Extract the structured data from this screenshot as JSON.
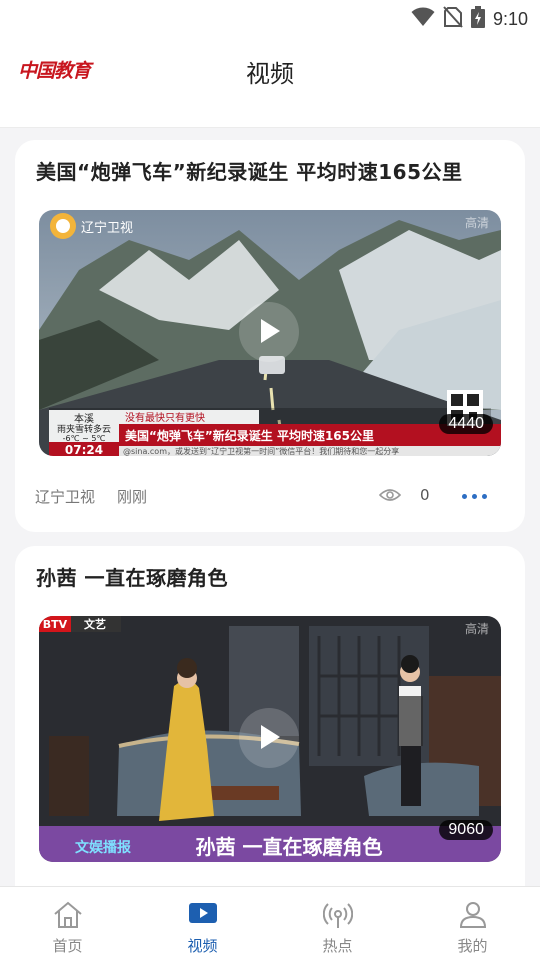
{
  "status_bar": {
    "time": "9:10",
    "icons": [
      "wifi-icon",
      "no-sim-icon",
      "battery-charging-icon"
    ]
  },
  "header": {
    "logo_text": "中国教育",
    "title": "视频"
  },
  "videos": [
    {
      "title": "美国“炮弹飞车”新纪录诞生 平均时速165公里",
      "source": "辽宁卫视",
      "time": "刚刚",
      "views": "0",
      "play_count": "4440",
      "quality_label": "高清",
      "channel_logo": "辽宁卫视",
      "lower_third": "美国“炮弹飞车”新纪录诞生   平均时速165公里",
      "ticker": "没有最快只有更快",
      "weather_city": "本溪",
      "weather_desc": "雨夹雪转多云",
      "weather_temp": "-6℃ ~ 5℃",
      "clock": "07:24",
      "crawl": "@sina.com，或发送到“辽宁卫视第一时间”微信平台！我们期待和您一起分享"
    },
    {
      "title": "孙茜 一直在琢磨角色",
      "play_count": "9060",
      "quality_label": "高清",
      "channel_logo": "BTV",
      "channel_sub": "文艺",
      "lower_third": "孙茜  一直在琢磨角色",
      "program_logo": "文娱播报"
    }
  ],
  "bottom_nav": [
    {
      "label": "首页",
      "icon": "home-icon",
      "active": false
    },
    {
      "label": "视频",
      "icon": "video-play-icon",
      "active": true
    },
    {
      "label": "热点",
      "icon": "broadcast-icon",
      "active": false
    },
    {
      "label": "我的",
      "icon": "user-icon",
      "active": false
    }
  ],
  "colors": {
    "accent": "#1d5fb0",
    "logo_red": "#c8161e",
    "more_dots": "#2d6ec3"
  }
}
